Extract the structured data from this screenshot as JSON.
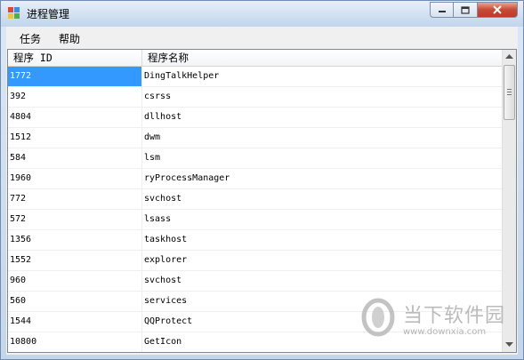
{
  "window": {
    "title": "进程管理",
    "caption_buttons": {
      "minimize": "▭",
      "maximize": "□",
      "close": "✕"
    }
  },
  "menu": {
    "items": [
      {
        "label": "任务"
      },
      {
        "label": "帮助"
      }
    ]
  },
  "process_list": {
    "columns": {
      "id": "程序 ID",
      "name": "程序名称"
    },
    "selected_color": "#3399ff",
    "rows": [
      {
        "id": "1772",
        "name": "DingTalkHelper"
      },
      {
        "id": "392",
        "name": "csrss"
      },
      {
        "id": "4804",
        "name": "dllhost"
      },
      {
        "id": "1512",
        "name": "dwm"
      },
      {
        "id": "584",
        "name": "lsm"
      },
      {
        "id": "1960",
        "name": "ryProcessManager"
      },
      {
        "id": "772",
        "name": "svchost"
      },
      {
        "id": "572",
        "name": "lsass"
      },
      {
        "id": "1356",
        "name": "taskhost"
      },
      {
        "id": "1552",
        "name": "explorer"
      },
      {
        "id": "960",
        "name": "svchost"
      },
      {
        "id": "560",
        "name": "services"
      },
      {
        "id": "1544",
        "name": "QQProtect"
      },
      {
        "id": "10800",
        "name": "GetIcon"
      }
    ]
  },
  "scrollbar": {
    "up_icon": "triangle-up-icon",
    "down_icon": "triangle-down-icon"
  },
  "watermark": {
    "text": "当下软件园",
    "url": "www.downxia.com"
  }
}
